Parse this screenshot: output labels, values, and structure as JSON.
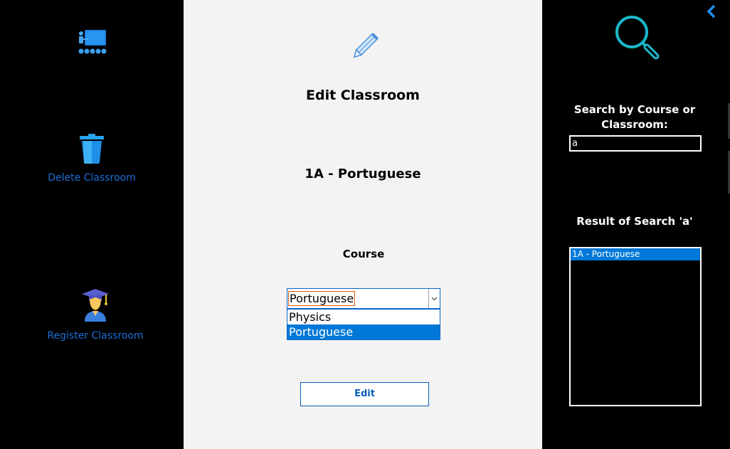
{
  "sidebar": {
    "logo_icon": "classroom-logo-icon",
    "delete_label": "Delete Classroom",
    "delete_icon": "trash-icon",
    "register_label": "Register Classroom",
    "register_icon": "graduate-icon",
    "accent_color": "#1a6fd6"
  },
  "main": {
    "title": "Edit Classroom",
    "classroom_name": "1A - Portuguese",
    "course_label": "Course",
    "course_selected": "Portuguese",
    "course_options": [
      "Physics",
      "Portuguese"
    ],
    "edit_label": "Edit"
  },
  "search": {
    "label": "Search by Course or Classroom:",
    "value": "a",
    "result_title": "Result of Search 'a'",
    "results": [
      "1A - Portuguese"
    ]
  },
  "colors": {
    "selection": "#0078d7",
    "panel_bg": "#f3f3f3"
  }
}
